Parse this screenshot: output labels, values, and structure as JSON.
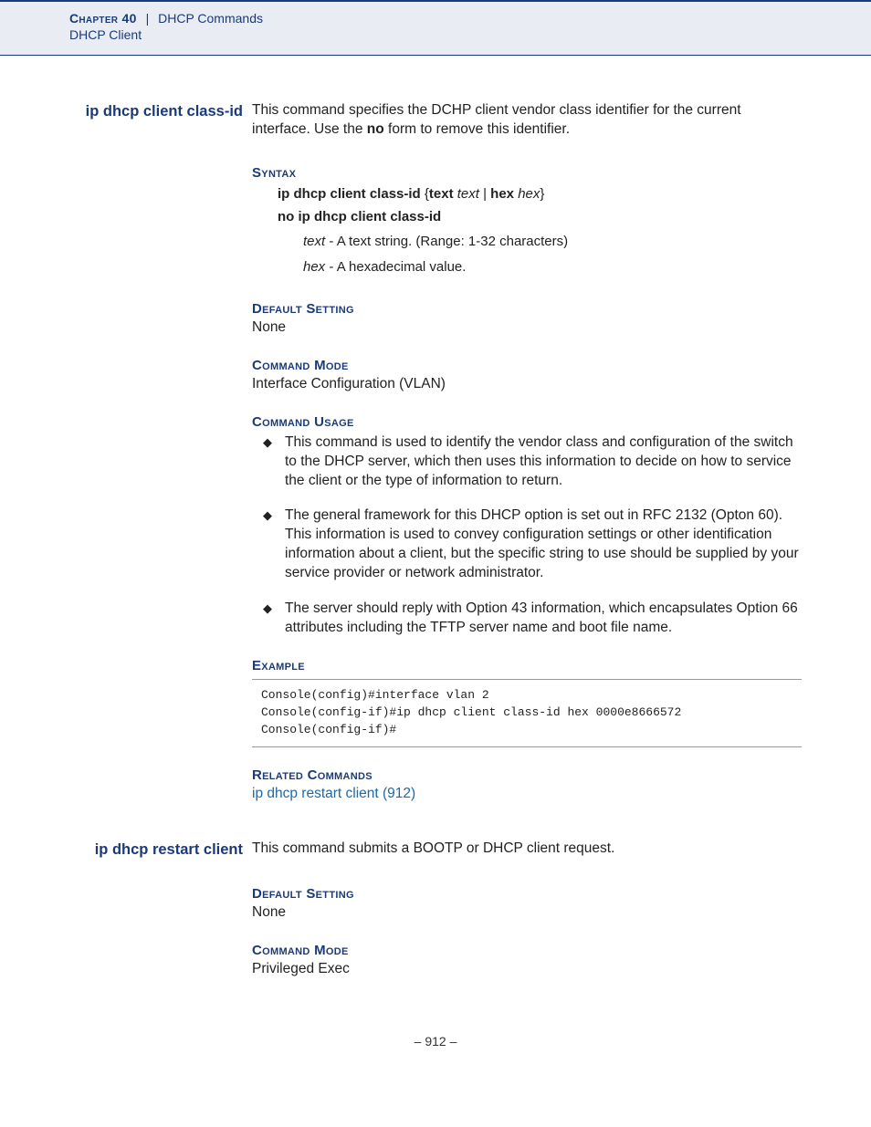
{
  "header": {
    "chapter": "Chapter 40",
    "separator": "|",
    "title": "DHCP Commands",
    "subtitle": "DHCP Client"
  },
  "cmd1": {
    "name": "ip dhcp client class-id",
    "desc_pre": "This command specifies the DCHP client vendor class identifier for the current interface. Use the ",
    "desc_bold": "no",
    "desc_post": " form to remove this identifier."
  },
  "syntax": {
    "title": "Syntax",
    "line1_b1": "ip dhcp client class-id",
    "line1_brace_open": " {",
    "line1_b2": "text",
    "line1_i1": " text",
    "line1_pipe": " | ",
    "line1_b3": "hex",
    "line1_i2": " hex",
    "line1_brace_close": "}",
    "line2": "no ip dhcp client class-id",
    "p1_i": "text",
    "p1_rest": " - A text string. (Range: 1-32 characters)",
    "p2_i": "hex",
    "p2_rest": " - A hexadecimal value."
  },
  "default1": {
    "title": "Default Setting",
    "body": "None"
  },
  "mode1": {
    "title": "Command Mode",
    "body": "Interface Configuration (VLAN)"
  },
  "usage": {
    "title": "Command Usage",
    "b1": "This command is used to identify the vendor class and configuration of the switch to the DHCP server, which then uses this information to decide on how to service the client or the type of information to return.",
    "b2": "The general framework for this DHCP option is set out in RFC 2132 (Opton 60). This information is used to convey configuration settings or other identification information about a client, but the specific string to use should be supplied by your service provider or network administrator.",
    "b3": "The server should reply with Option 43 information, which encapsulates Option 66 attributes including the TFTP server name and boot file name."
  },
  "example": {
    "title": "Example",
    "code": "Console(config)#interface vlan 2\nConsole(config-if)#ip dhcp client class-id hex 0000e8666572\nConsole(config-if)#"
  },
  "related": {
    "title": "Related Commands",
    "link": "ip dhcp restart client (912)"
  },
  "cmd2": {
    "name": "ip dhcp restart client",
    "desc": "This command submits a BOOTP or DHCP client request."
  },
  "default2": {
    "title": "Default Setting",
    "body": "None"
  },
  "mode2": {
    "title": "Command Mode",
    "body": "Privileged Exec"
  },
  "pagenum": "– 912 –"
}
